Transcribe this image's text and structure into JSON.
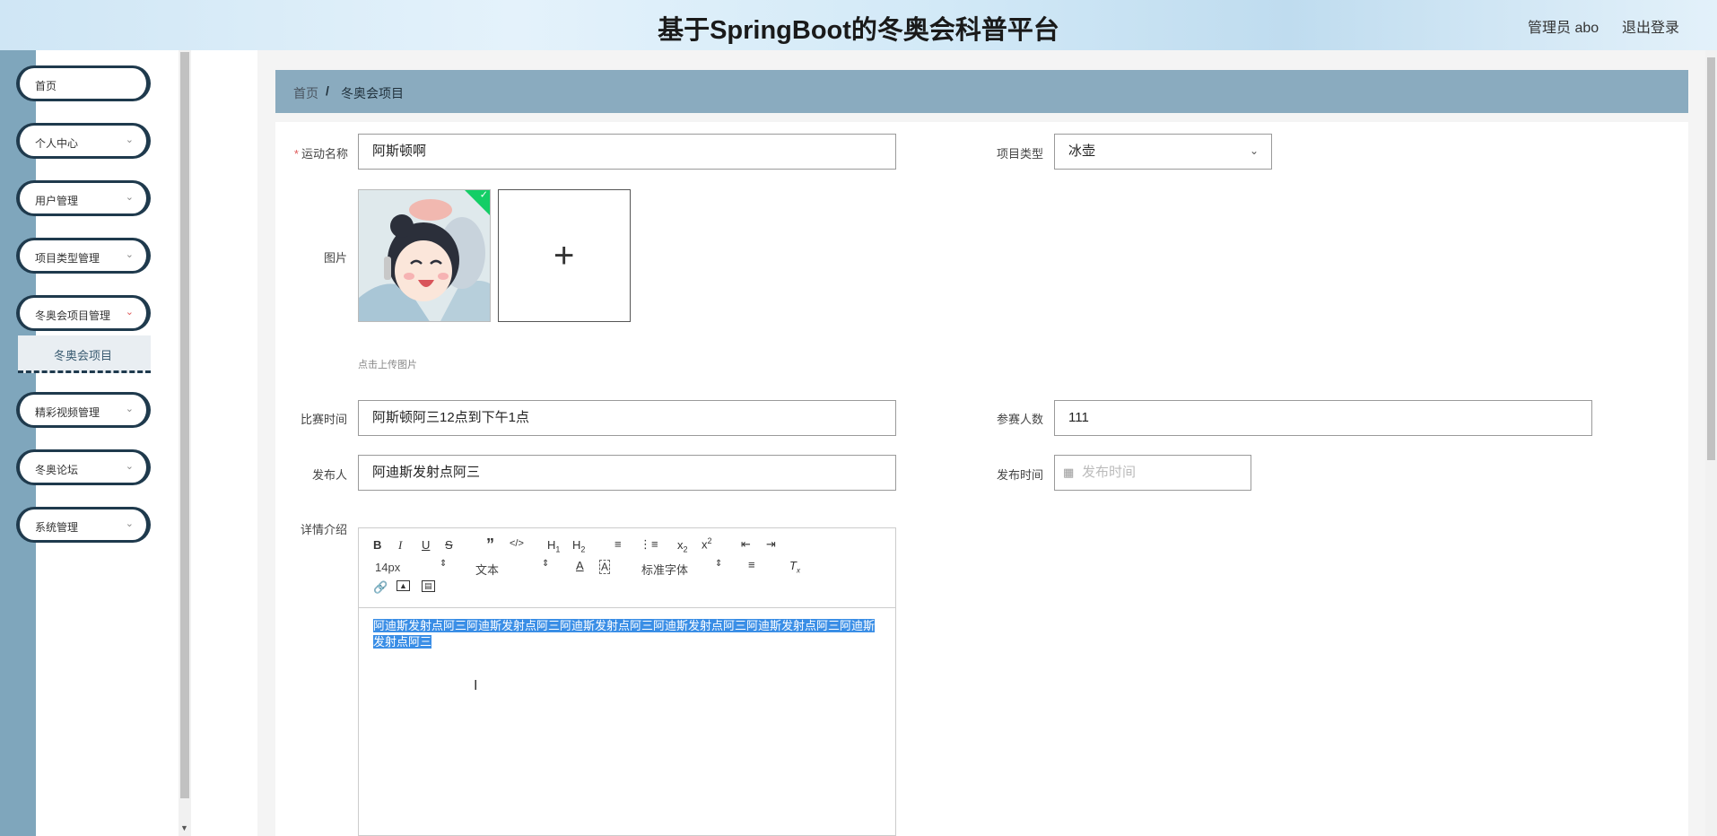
{
  "header": {
    "title": "基于SpringBoot的冬奥会科普平台",
    "user": "管理员 abo",
    "logout": "退出登录"
  },
  "sidebar": {
    "items": [
      {
        "label": "首页",
        "has_arrow": false
      },
      {
        "label": "个人中心",
        "has_arrow": true
      },
      {
        "label": "用户管理",
        "has_arrow": true
      },
      {
        "label": "项目类型管理",
        "has_arrow": true
      },
      {
        "label": "冬奥会项目管理",
        "has_arrow": true,
        "open": true
      },
      {
        "label": "精彩视频管理",
        "has_arrow": true
      },
      {
        "label": "冬奥论坛",
        "has_arrow": true
      },
      {
        "label": "系统管理",
        "has_arrow": true
      }
    ],
    "submenu_label": "冬奥会项目",
    "colors": {
      "rail": "#7fa6bc",
      "border": "#1f3a4d"
    }
  },
  "breadcrumb": {
    "home": "首页",
    "separator": "/",
    "current": "冬奥会项目"
  },
  "form": {
    "name": {
      "label": "运动名称",
      "required": true,
      "value": "阿斯顿啊"
    },
    "type": {
      "label": "项目类型",
      "value": "冰壶"
    },
    "image": {
      "label": "图片",
      "hint": "点击上传图片",
      "uploaded": true
    },
    "match_time": {
      "label": "比赛时间",
      "value": "阿斯顿阿三12点到下午1点"
    },
    "participants": {
      "label": "参赛人数",
      "value": "111"
    },
    "publisher": {
      "label": "发布人",
      "value": "阿迪斯发射点阿三"
    },
    "publish_time": {
      "label": "发布时间",
      "placeholder": "发布时间",
      "value": ""
    },
    "detail": {
      "label": "详情介绍",
      "toolbar": {
        "font_size": "14px",
        "header": "文本",
        "font": "标准字体"
      },
      "content": "阿迪斯发射点阿三阿迪斯发射点阿三阿迪斯发射点阿三阿迪斯发射点阿三阿迪斯发射点阿三阿迪斯发射点阿三"
    }
  },
  "colors": {
    "breadcrumb_bg": "#8aabbf",
    "selection": "#3a8ee6",
    "success": "#13ce66",
    "required": "#e05a5a"
  }
}
